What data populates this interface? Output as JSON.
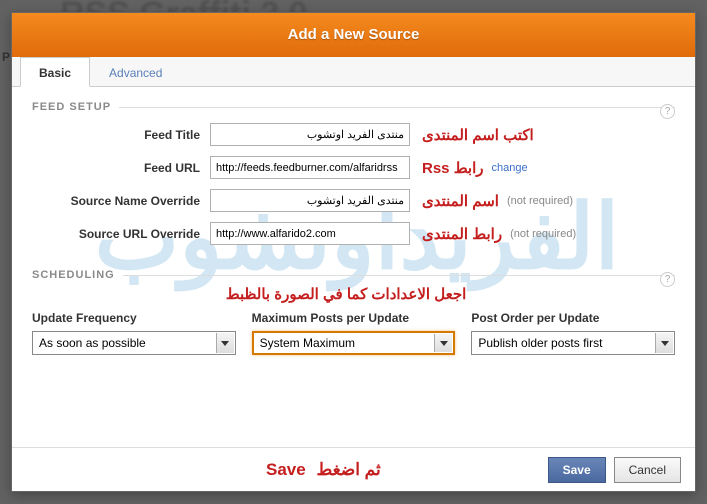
{
  "bg_text": "RSS Graffiti 2.0",
  "bg_p": "P",
  "dialog_title": "Add a New Source",
  "tabs": {
    "basic": "Basic",
    "advanced": "Advanced"
  },
  "feed_setup": {
    "legend": "FEED SETUP",
    "rows": {
      "title": {
        "label": "Feed Title",
        "value": "منتدى الفريد اوتشوب",
        "ann": "اكتب اسم المنتدى"
      },
      "url": {
        "label": "Feed URL",
        "value": "http://feeds.feedburner.com/alfaridrss",
        "ann": "رابط Rss",
        "change": "change"
      },
      "name_override": {
        "label": "Source Name Override",
        "value": "منتدى الفريد اوتشوب",
        "ann": "اسم المنتدى",
        "hint": "(not required)"
      },
      "url_override": {
        "label": "Source URL Override",
        "value": "http://www.alfarido2.com",
        "ann": "رابط المنتدى",
        "hint": "(not required)"
      }
    }
  },
  "scheduling": {
    "legend": "SCHEDULING",
    "ann": "اجعل الاعدادات كما في الصورة بالظبط",
    "cols": {
      "freq": {
        "label": "Update Frequency",
        "value": "As soon as possible"
      },
      "max": {
        "label": "Maximum Posts per Update",
        "value": "System Maximum"
      },
      "order": {
        "label": "Post Order per Update",
        "value": "Publish older posts first"
      }
    }
  },
  "footer": {
    "ann": "ثم اضغط",
    "save_big": "Save",
    "save": "Save",
    "cancel": "Cancel"
  },
  "help": "?"
}
